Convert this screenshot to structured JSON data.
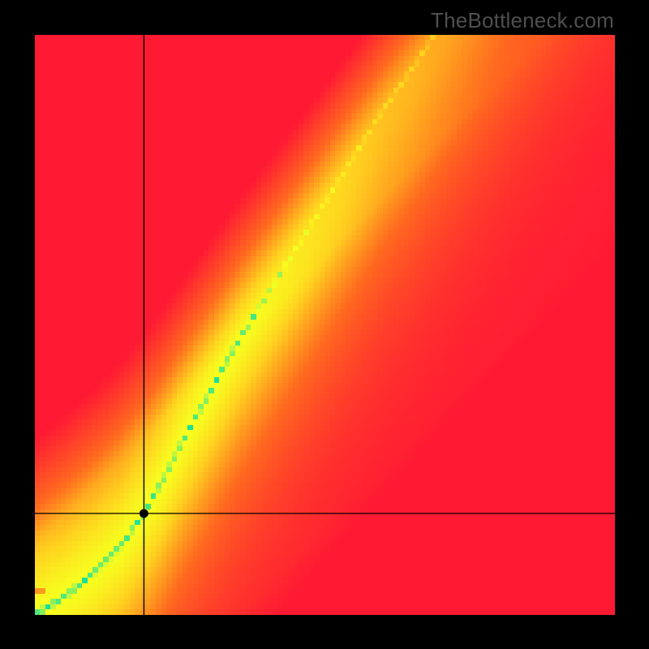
{
  "watermark": "TheBottleneck.com",
  "chart_data": {
    "type": "heatmap",
    "title": "",
    "xlabel": "",
    "ylabel": "",
    "xlim": [
      0,
      1
    ],
    "ylim": [
      0,
      1
    ],
    "crosshair": {
      "x": 0.188,
      "y": 0.175
    },
    "marker": {
      "x": 0.188,
      "y": 0.175
    },
    "optimal_curve": [
      {
        "x": 0.0,
        "y": 0.0
      },
      {
        "x": 0.05,
        "y": 0.03
      },
      {
        "x": 0.1,
        "y": 0.07
      },
      {
        "x": 0.15,
        "y": 0.12
      },
      {
        "x": 0.188,
        "y": 0.175
      },
      {
        "x": 0.22,
        "y": 0.23
      },
      {
        "x": 0.25,
        "y": 0.29
      },
      {
        "x": 0.3,
        "y": 0.38
      },
      {
        "x": 0.35,
        "y": 0.47
      },
      {
        "x": 0.4,
        "y": 0.55
      },
      {
        "x": 0.45,
        "y": 0.63
      },
      {
        "x": 0.5,
        "y": 0.71
      },
      {
        "x": 0.55,
        "y": 0.79
      },
      {
        "x": 0.6,
        "y": 0.87
      },
      {
        "x": 0.65,
        "y": 0.94
      },
      {
        "x": 0.69,
        "y": 1.0
      }
    ],
    "band_width_norm": 0.06,
    "gradient_stops": [
      {
        "t": 0.0,
        "color": "#ff1a33"
      },
      {
        "t": 0.4,
        "color": "#ff6a1f"
      },
      {
        "t": 0.7,
        "color": "#ffd21f"
      },
      {
        "t": 0.88,
        "color": "#f7ff1f"
      },
      {
        "t": 1.0,
        "color": "#18e09a"
      }
    ],
    "grid_resolution": 110
  }
}
